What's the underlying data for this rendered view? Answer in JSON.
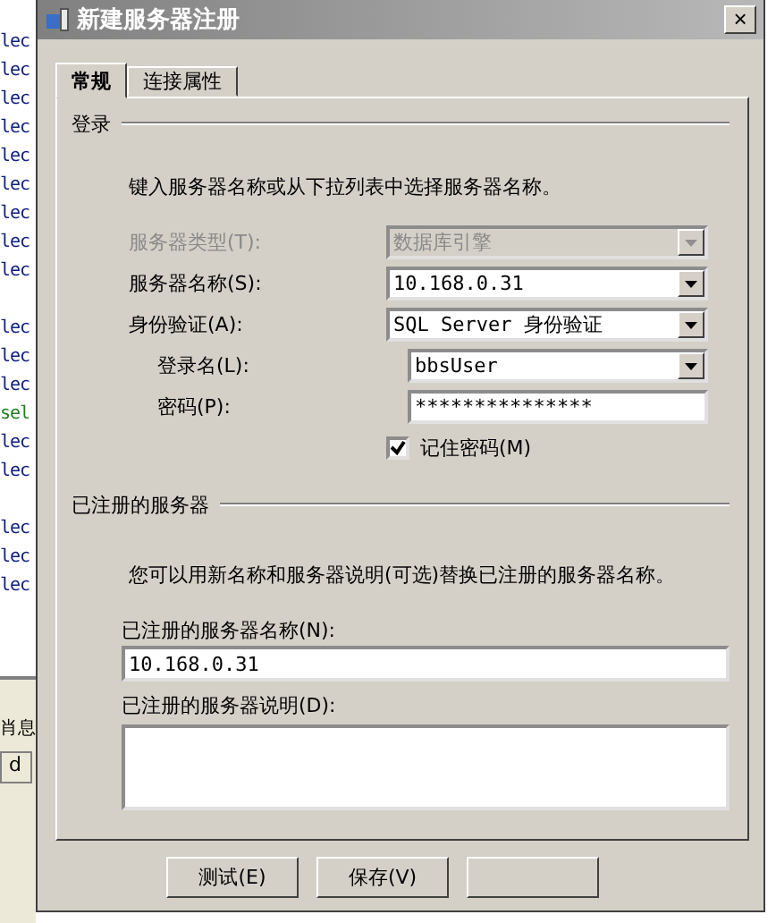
{
  "background_editor": {
    "lines": [
      {
        "text": "lec",
        "kind": "code"
      },
      {
        "text": "lec",
        "kind": "code"
      },
      {
        "text": "lec",
        "kind": "code"
      },
      {
        "text": "lec",
        "kind": "code"
      },
      {
        "text": "lec",
        "kind": "code"
      },
      {
        "text": "lec",
        "kind": "code"
      },
      {
        "text": "lec",
        "kind": "code"
      },
      {
        "text": "lec",
        "kind": "code"
      },
      {
        "text": "lec",
        "kind": "code"
      },
      {
        "kind": "blank"
      },
      {
        "text": "lec",
        "kind": "code"
      },
      {
        "text": "lec",
        "kind": "code"
      },
      {
        "text": "lec",
        "kind": "code"
      },
      {
        "text": "sel",
        "kind": "keyword"
      },
      {
        "text": "lec",
        "kind": "code"
      },
      {
        "text": "lec",
        "kind": "code"
      },
      {
        "kind": "blank"
      },
      {
        "text": "lec",
        "kind": "code"
      },
      {
        "text": "lec",
        "kind": "code"
      },
      {
        "text": "lec",
        "kind": "code"
      }
    ],
    "tab_label": "肖息",
    "button_label": "d"
  },
  "window": {
    "title": "新建服务器注册",
    "close": "×"
  },
  "tabs": [
    {
      "label": "常规",
      "selected": true
    },
    {
      "label": "连接属性",
      "selected": false
    }
  ],
  "login": {
    "heading": "登录",
    "instruction": "键入服务器名称或从下拉列表中选择服务器名称。",
    "fields": [
      {
        "label": "服务器类型(T):",
        "value": "数据库引擎",
        "kind": "combo",
        "disabled": true,
        "indented": false
      },
      {
        "label": "服务器名称(S):",
        "value": "10.168.0.31",
        "kind": "combo",
        "disabled": false,
        "indented": false
      },
      {
        "label": "身份验证(A):",
        "value": "SQL Server 身份验证",
        "kind": "combo",
        "disabled": false,
        "indented": false
      },
      {
        "label": "登录名(L):",
        "value": "bbsUser",
        "kind": "combo",
        "disabled": false,
        "indented": true
      },
      {
        "label": "密码(P):",
        "value": "***************",
        "kind": "text",
        "disabled": false,
        "indented": true
      }
    ],
    "remember": {
      "label": "记住密码(M)",
      "checked": true
    }
  },
  "registered": {
    "heading": "已注册的服务器",
    "instruction": "您可以用新名称和服务器说明(可选)替换已注册的服务器名称。",
    "name_label": "已注册的服务器名称(N):",
    "name_value": "10.168.0.31",
    "description_label": "已注册的服务器说明(D):"
  },
  "buttons": [
    "测试(E)",
    "保存(V)"
  ]
}
